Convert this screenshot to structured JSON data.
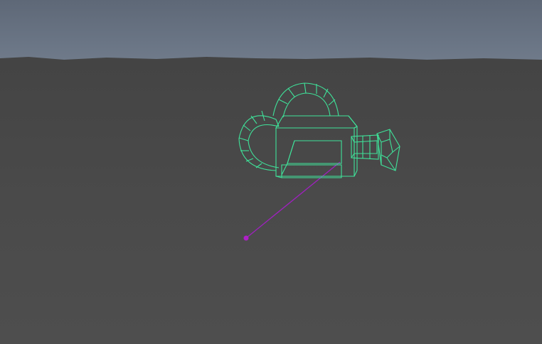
{
  "viewport": {
    "sky_color_top": "#5e6877",
    "sky_color_horizon": "#75808f",
    "ground_color_far": "#454545",
    "ground_color_near": "#4d4d4d",
    "wireframe_color": "#3fe39a",
    "aim_line_color": "#a020c0",
    "aim_point_color": "#b020c8"
  },
  "scene": {
    "objects": [
      {
        "name": "camera",
        "type": "camera-wireframe",
        "selected": true
      },
      {
        "name": "camera-aim",
        "type": "aim-locator"
      }
    ]
  }
}
